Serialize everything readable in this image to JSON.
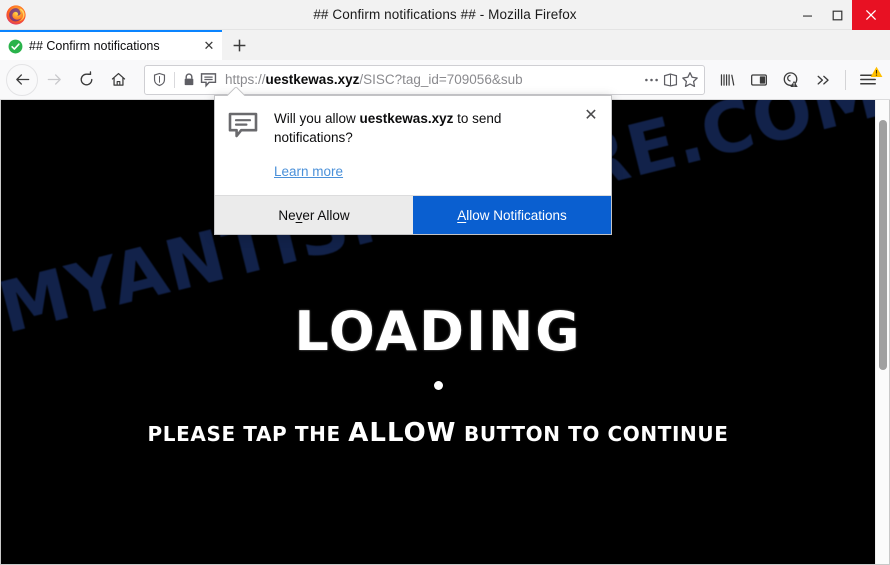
{
  "window": {
    "title": "## Confirm notifications ## - Mozilla Firefox",
    "logo_icon": "firefox-logo",
    "controls": {
      "minimize": "minimize-icon",
      "maximize": "maximize-icon",
      "close": "close-icon"
    },
    "close_button_color": "#e81123"
  },
  "tabs": {
    "active": {
      "favicon": "green-check-circle-icon",
      "label": "## Confirm notifications",
      "close_label": "✕"
    },
    "new_tab_label": "+"
  },
  "toolbar": {
    "back_icon": "back-arrow-icon",
    "forward_icon": "forward-arrow-icon",
    "reload_icon": "reload-icon",
    "home_icon": "home-icon",
    "library_icon": "library-icon",
    "sidebar_icon": "sidebar-icon",
    "account_icon": "account-warning-icon",
    "overflow_icon": "chevron-double-right-icon",
    "menu_icon": "hamburger-menu-icon",
    "menu_badge_icon": "warning-triangle-icon",
    "menu_badge_color": "#ffbf00"
  },
  "urlbar": {
    "shield_icon": "tracking-protection-shield-icon",
    "lock_icon": "padlock-icon",
    "notification_icon": "notification-permission-icon",
    "url_scheme": "https://",
    "url_host": "uestkewas.xyz",
    "url_path": "/SISC?tag_id=709056&sub",
    "page_actions_icon": "ellipsis-icon",
    "reader_icon": "reader-view-icon",
    "bookmark_icon": "star-icon"
  },
  "doorhanger": {
    "icon": "speech-bubble-icon",
    "question_prefix": "Will you allow ",
    "question_host": "uestkewas.xyz",
    "question_suffix": " to send notifications?",
    "learn_more": "Learn more",
    "close_label": "✕",
    "never_allow": {
      "pre": "Ne",
      "key": "v",
      "post": "er Allow"
    },
    "allow": {
      "key": "A",
      "post": "llow Notifications"
    },
    "allow_button_color": "#0a5fd0",
    "never_button_color": "#ebebeb"
  },
  "page": {
    "background_color": "#000000",
    "watermark_text": "MYANTISPYWARE.COM",
    "watermark_color": "#13244e",
    "loading_text": "LOADING",
    "loading_dot": "●",
    "tagline_before": "PLEASE TAP THE ",
    "tagline_emphasis": "ALLOW",
    "tagline_after": " BUTTON TO CONTINUE",
    "text_color": "#ffffff"
  }
}
